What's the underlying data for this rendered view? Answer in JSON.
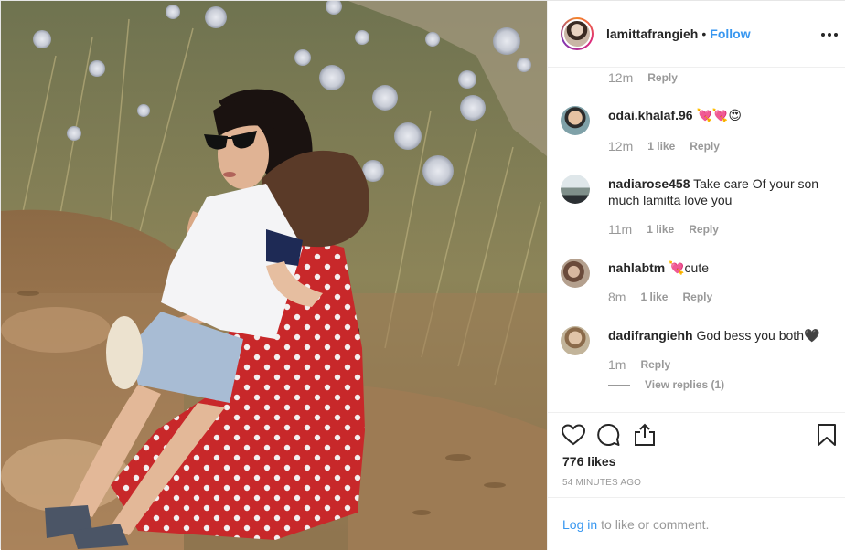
{
  "header": {
    "username": "lamittafrangieh",
    "separator": "•",
    "follow_label": "Follow"
  },
  "top_comment_meta": {
    "time": "12m",
    "reply_label": "Reply"
  },
  "comments": [
    {
      "user": "odai.khalaf.96",
      "text": "💘💘😍",
      "time": "12m",
      "likes": "1 like",
      "reply_label": "Reply"
    },
    {
      "user": "nadiarose458",
      "text": "Take care Of your son much lamitta love you",
      "time": "11m",
      "likes": "1 like",
      "reply_label": "Reply"
    },
    {
      "user": "nahlabtm",
      "text": "💘cute",
      "time": "8m",
      "likes": "1 like",
      "reply_label": "Reply"
    },
    {
      "user": "dadifrangiehh",
      "text": "God bess you both🖤",
      "time": "1m",
      "likes": "",
      "reply_label": "Reply"
    }
  ],
  "view_replies_label": "View replies (1)",
  "likes_count": "776 likes",
  "posted_ago": "54 MINUTES AGO",
  "login": {
    "link_label": "Log in",
    "rest_text": "to like or comment."
  },
  "colors": {
    "accent": "#3897f0",
    "muted": "#999999",
    "text": "#262626",
    "border": "#efefef"
  },
  "icons": [
    "more-options-icon",
    "heart-icon",
    "comment-icon",
    "share-icon",
    "bookmark-icon"
  ]
}
